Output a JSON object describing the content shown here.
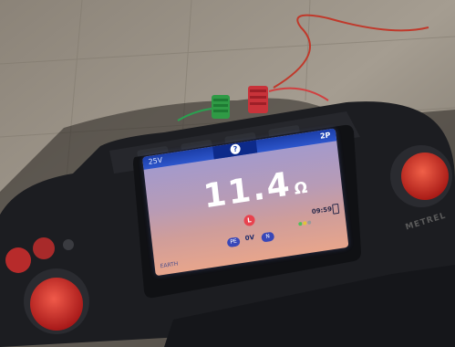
{
  "display": {
    "voltage_label": "25V",
    "help_symbol": "?",
    "mode_label": "2P",
    "reading_value": "11.4",
    "reading_unit": "Ω",
    "limit_badge": "L",
    "pe_chip": "PE",
    "zero_voltage": "0V",
    "n_chip": "N",
    "clock": "09:59",
    "earth_label": "EARTH",
    "status_dot_colors": [
      "#4fbf5a",
      "#e0c53a",
      "#9a9a9a"
    ]
  },
  "device": {
    "brand": "METREL"
  },
  "colors": {
    "display_header": "#2d56cc",
    "knob_red": "#d22a2a",
    "lead_red": "#cc2f33",
    "lead_green": "#2aa050"
  }
}
